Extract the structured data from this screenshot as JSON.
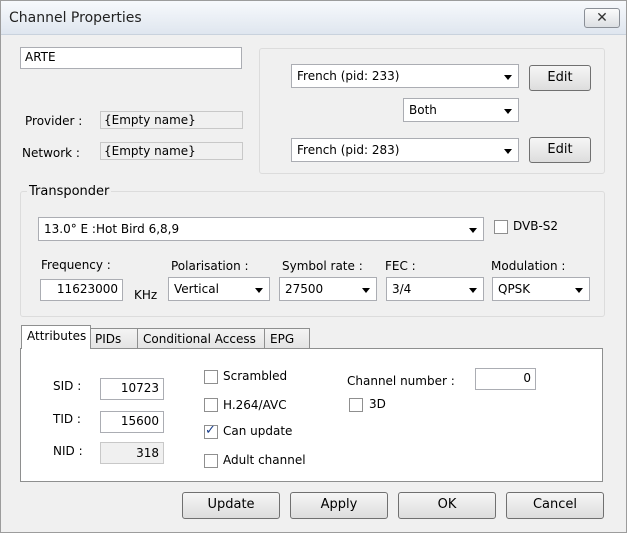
{
  "window": {
    "title": "Channel Properties",
    "close_glyph": "✕"
  },
  "channel_name": "ARTE",
  "provider": {
    "label": "Provider :",
    "value": "{Empty name}"
  },
  "network": {
    "label": "Network :",
    "value": "{Empty name}"
  },
  "audio": {
    "track1": "French  (pid: 233)",
    "track1_edit": "Edit",
    "channel_mode": "Both",
    "track2": "French  (pid: 283)",
    "track2_edit": "Edit"
  },
  "transponder": {
    "title": "Transponder",
    "satellite": "13.0° E :Hot Bird 6,8,9",
    "dvbs2_label": "DVB-S2",
    "dvbs2_checked": false,
    "frequency_label": "Frequency :",
    "frequency_value": "11623000",
    "frequency_unit": "KHz",
    "polarisation_label": "Polarisation :",
    "polarisation_value": "Vertical",
    "symbol_rate_label": "Symbol rate :",
    "symbol_rate_value": "27500",
    "fec_label": "FEC :",
    "fec_value": "3/4",
    "modulation_label": "Modulation :",
    "modulation_value": "QPSK"
  },
  "tabs": [
    {
      "label": "Attributes",
      "active": true
    },
    {
      "label": "PIDs",
      "active": false
    },
    {
      "label": "Conditional Access",
      "active": false
    },
    {
      "label": "EPG",
      "active": false
    }
  ],
  "attributes": {
    "sid_label": "SID :",
    "sid_value": "10723",
    "tid_label": "TID :",
    "tid_value": "15600",
    "nid_label": "NID :",
    "nid_value": "318",
    "scrambled_label": "Scrambled",
    "scrambled_checked": false,
    "h264_label": "H.264/AVC",
    "h264_checked": false,
    "can_update_label": "Can update",
    "can_update_checked": true,
    "adult_label": "Adult channel",
    "adult_checked": false,
    "channel_number_label": "Channel number :",
    "channel_number_value": "0",
    "three_d_label": "3D",
    "three_d_checked": false
  },
  "buttons": {
    "update": "Update",
    "apply": "Apply",
    "ok": "OK",
    "cancel": "Cancel"
  },
  "check_glyph": "✓"
}
